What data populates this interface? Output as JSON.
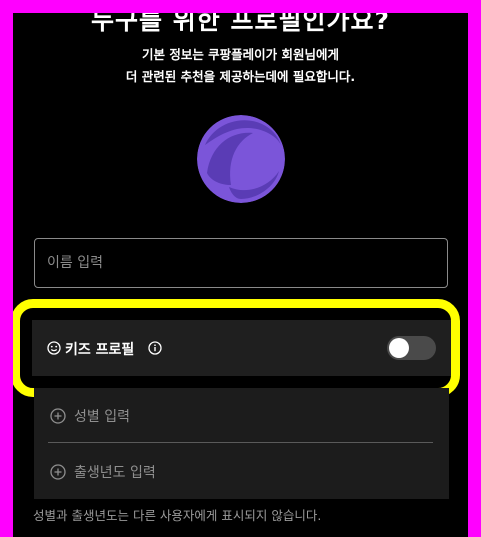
{
  "header": {
    "title": "누구를 위한 프로필인가요?",
    "subtitle_line1": "기본 정보는 쿠팡플레이가 회원님에게",
    "subtitle_line2": "더 관련된 추천을 제공하는데에 필요합니다."
  },
  "avatar": {
    "icon": "profile-avatar-icon",
    "color_primary": "#7b55d9",
    "color_dark": "#5a3cb5"
  },
  "name_field": {
    "placeholder": "이름 입력",
    "value": ""
  },
  "kids_profile": {
    "label": "키즈 프로필",
    "icon": "kids-face-icon",
    "info_icon": "info-icon",
    "toggle_on": false
  },
  "extra_fields": {
    "gender_label": "성별 입력",
    "birth_year_label": "출생년도 입력",
    "icon": "plus-circle-icon"
  },
  "footnote": "성별과 출생년도는 다른 사용자에게 표시되지 않습니다.",
  "colors": {
    "background": "#000000",
    "highlight": "#ffff00",
    "border": "#ff00ff"
  }
}
